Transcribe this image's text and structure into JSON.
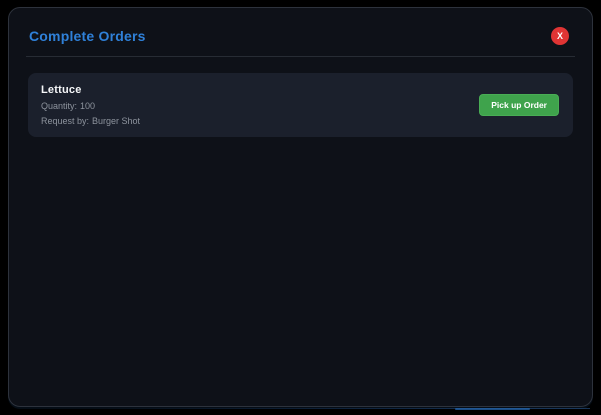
{
  "window": {
    "title": "Complete Orders",
    "close_label": "X"
  },
  "orders": [
    {
      "name": "Lettuce",
      "quantity_label": "Quantity:",
      "quantity_value": "100",
      "request_label": "Request by:",
      "request_value": "Burger Shot",
      "pickup_button_label": "Pick up Order"
    }
  ],
  "colors": {
    "background": "#000000",
    "panel_body": "#0e1118",
    "panel_border": "#2d323c",
    "card_background": "#1b202c",
    "title_blue": "#2f80d8",
    "close_red": "#e03434",
    "pickup_green": "#3fa34c",
    "muted_text": "#8d939d",
    "bottom_accent_blue": "#2466ad"
  }
}
